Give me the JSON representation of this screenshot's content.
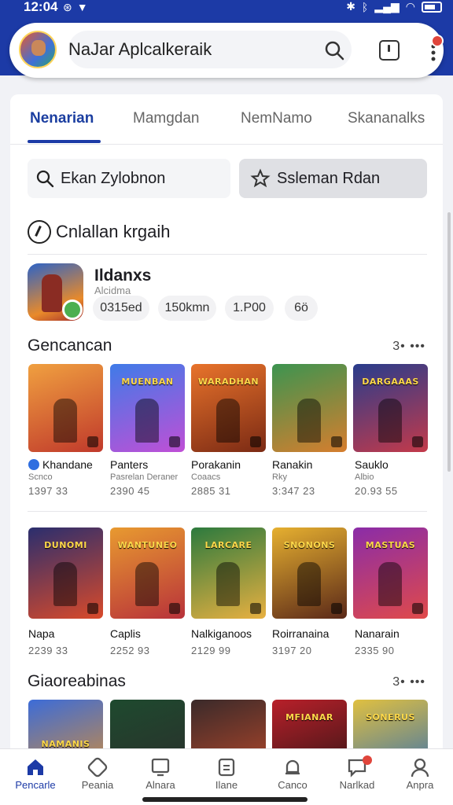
{
  "status": {
    "time": "12:04"
  },
  "search": {
    "value": "NaJar Aplcalkeraik"
  },
  "tabs": [
    {
      "label": "Nenarian",
      "active": true
    },
    {
      "label": "Mamgdan",
      "active": false
    },
    {
      "label": "NemNamo",
      "active": false
    },
    {
      "label": "Skananalks",
      "active": false
    }
  ],
  "chips": {
    "left": "Ekan Zylobnon",
    "right": "Ssleman Rdan"
  },
  "section": {
    "title": "Cnlallan krgaih"
  },
  "featured": {
    "name": "Ildanxs",
    "subtitle": "Alcidma",
    "pills": [
      "0315ed",
      "150kmn",
      "1.P00",
      "6ö"
    ]
  },
  "row1": {
    "title": "Gencancan",
    "more": "3• •••",
    "games": [
      {
        "thumb_title": "",
        "title": "Khandane",
        "sub": "Scnco",
        "meta": "1397 33",
        "verified": true,
        "colors": [
          "#f0a040",
          "#c0392b"
        ]
      },
      {
        "thumb_title": "MUENBAN",
        "title": "Panters",
        "sub": "Pasrelan Deraner",
        "meta": "2390 45",
        "verified": false,
        "colors": [
          "#3f7be8",
          "#c04fd6"
        ]
      },
      {
        "thumb_title": "WARADHAN",
        "title": "Porakanin",
        "sub": "Coaacs",
        "meta": "2885 31",
        "verified": false,
        "colors": [
          "#e8732b",
          "#7b2a14"
        ]
      },
      {
        "thumb_title": "",
        "title": "Ranakin",
        "sub": "Rky",
        "meta": "3:347 23",
        "verified": false,
        "colors": [
          "#3c9450",
          "#d67e2e"
        ]
      },
      {
        "thumb_title": "DARGAAAS",
        "title": "Sauklo",
        "sub": "Albio",
        "meta": "20.93 55",
        "verified": false,
        "colors": [
          "#283c8c",
          "#c43a4a"
        ]
      }
    ]
  },
  "row2": {
    "games": [
      {
        "thumb_title": "DUNOMI",
        "title": "Napa",
        "meta": "2239 33",
        "colors": [
          "#2a2e6e",
          "#d94a2a"
        ]
      },
      {
        "thumb_title": "WANTUNEO",
        "title": "Caplis",
        "meta": "2252 93",
        "colors": [
          "#e89a30",
          "#b8323a"
        ]
      },
      {
        "thumb_title": "LARCARE",
        "title": "Nalkiganoos",
        "meta": "2129 99",
        "colors": [
          "#2c7a3e",
          "#e8b040"
        ]
      },
      {
        "thumb_title": "SNONONS",
        "title": "Roirranaina",
        "meta": "3197 20",
        "colors": [
          "#e6b030",
          "#5a2818"
        ]
      },
      {
        "thumb_title": "MASTUAS",
        "title": "Nanarain",
        "meta": "2335 90",
        "colors": [
          "#8a2ca8",
          "#e04a4a"
        ]
      }
    ]
  },
  "row3": {
    "title": "Giaoreabinas",
    "more": "3• •••",
    "games": [
      {
        "thumb_title": "NAMANIS",
        "colors": [
          "#3c6cd8",
          "#e0902a"
        ]
      },
      {
        "thumb_title": "",
        "colors": [
          "#1e4a2e",
          "#2c2c2c"
        ]
      },
      {
        "thumb_title": "",
        "colors": [
          "#3a2a2a",
          "#c04a2a"
        ]
      },
      {
        "thumb_title": "MFIANAR",
        "colors": [
          "#b8202a",
          "#2a1414"
        ]
      },
      {
        "thumb_title": "SONERUS",
        "colors": [
          "#e0c040",
          "#2c6ab8"
        ]
      }
    ]
  },
  "nav": [
    {
      "label": "Pencarle",
      "icon": "home-icon",
      "active": true
    },
    {
      "label": "Peania",
      "icon": "games-icon",
      "active": false
    },
    {
      "label": "Alnara",
      "icon": "apps-icon",
      "active": false
    },
    {
      "label": "Ilane",
      "icon": "library-icon",
      "active": false
    },
    {
      "label": "Canco",
      "icon": "bell-icon",
      "active": false
    },
    {
      "label": "Narlkad",
      "icon": "chat-icon",
      "active": false
    },
    {
      "label": "Anpra",
      "icon": "profile-icon",
      "active": false
    }
  ],
  "colors": {
    "brand": "#1c3aa6",
    "notification": "#e0453b"
  }
}
